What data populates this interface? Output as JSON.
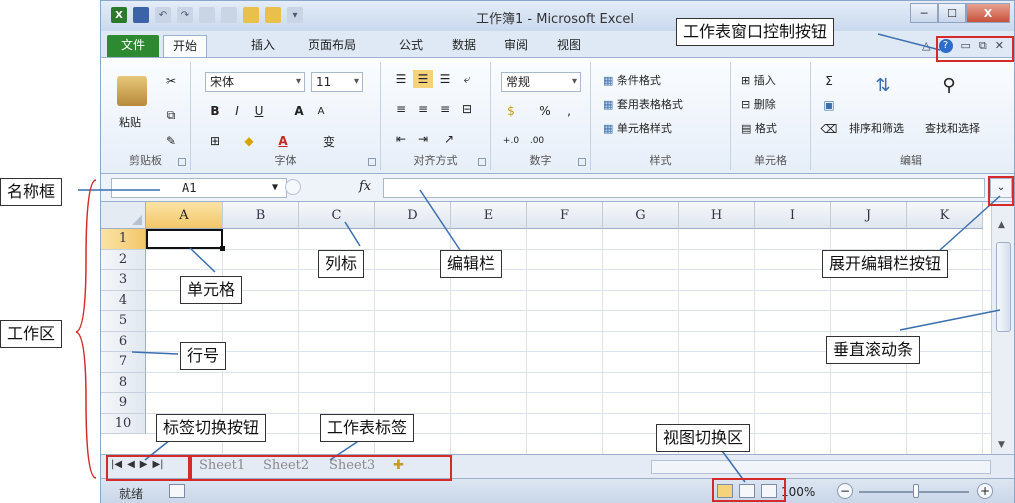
{
  "window": {
    "title": "工作簿1 - Microsoft Excel",
    "min_label": "─",
    "max_label": "☐",
    "close_label": "X"
  },
  "quick_access": [
    "X",
    "■",
    "↶",
    "↷",
    "▢",
    "▢",
    "▭",
    "▭",
    "▾"
  ],
  "ribbon_tabs": [
    "文件",
    "开始",
    "插入",
    "页面布局",
    "公式",
    "数据",
    "审阅",
    "视图"
  ],
  "ribbon": {
    "clipboard": {
      "label": "剪贴板",
      "paste": "粘贴"
    },
    "font": {
      "label": "字体",
      "family": "宋体",
      "size": "11",
      "bold": "B",
      "italic": "I",
      "underline": "U",
      "grow": "A",
      "shrink": "A",
      "color_a": "A",
      "wen": "变"
    },
    "alignment": {
      "label": "对齐方式"
    },
    "number": {
      "label": "数字",
      "format": "常规",
      "percent": "%",
      "comma": ",",
      "inc": "+.0",
      "dec": ".00"
    },
    "styles": {
      "label": "样式",
      "conditional": "条件格式",
      "table": "套用表格格式",
      "cell": "单元格样式"
    },
    "cells": {
      "label": "单元格",
      "insert": "插入",
      "delete": "删除",
      "format": "格式"
    },
    "editing": {
      "label": "编辑",
      "sum": "Σ",
      "sort": "排序和筛选",
      "find": "查找和选择"
    }
  },
  "formula_bar": {
    "name_box": "A1",
    "fx": "fx",
    "value": ""
  },
  "columns": [
    "A",
    "B",
    "C",
    "D",
    "E",
    "F",
    "G",
    "H",
    "I",
    "J",
    "K"
  ],
  "rows": [
    "1",
    "2",
    "3",
    "4",
    "5",
    "6",
    "7",
    "8",
    "9",
    "10"
  ],
  "sheet_tabs": [
    "Sheet1",
    "Sheet2",
    "Sheet3"
  ],
  "status": {
    "ready": "就绪",
    "zoom": "100%",
    "zoom_out": "−",
    "zoom_in": "+"
  },
  "annotations": {
    "window_controls": "工作表窗口控制按钮",
    "name_box": "名称框",
    "work_area": "工作区",
    "cell": "单元格",
    "column_header": "列标",
    "edit_bar": "编辑栏",
    "expand_edit_bar": "展开编辑栏按钮",
    "vertical_scroll": "垂直滚动条",
    "row_number": "行号",
    "tab_nav_buttons": "标签切换按钮",
    "sheet_tabs": "工作表标签",
    "view_switch": "视图切换区"
  }
}
